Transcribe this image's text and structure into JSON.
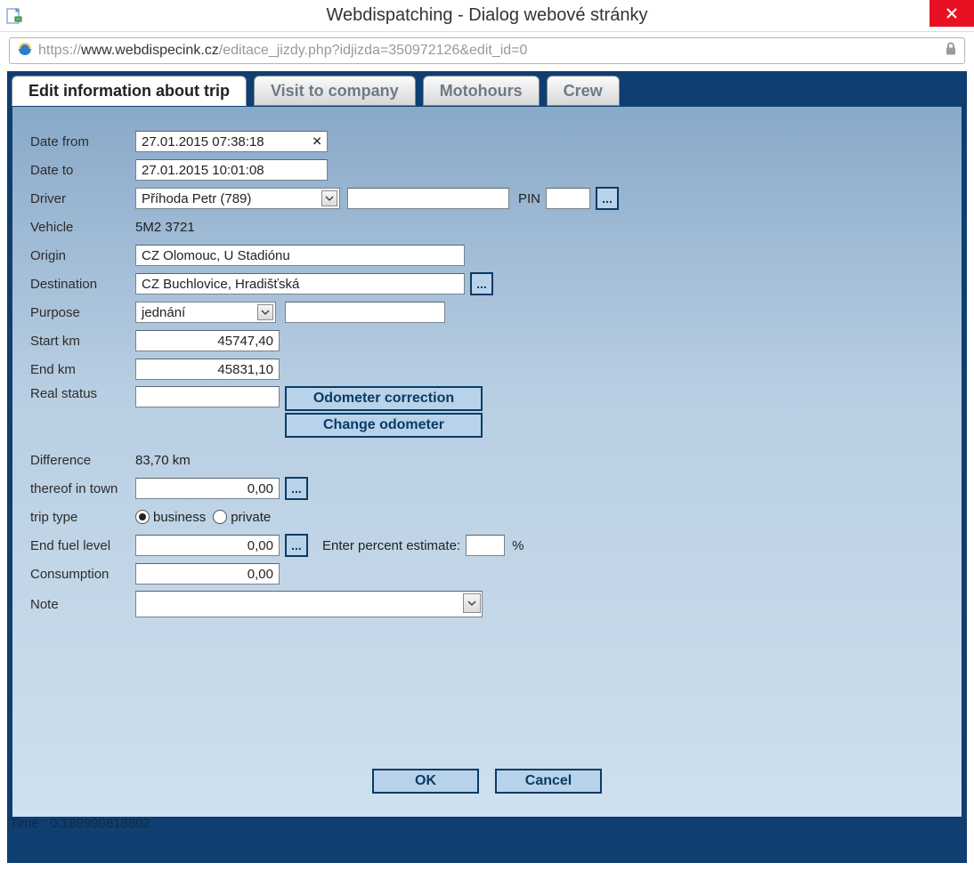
{
  "window": {
    "title": "Webdispatching - Dialog webové stránky",
    "close_label": "✕"
  },
  "url": {
    "proto": "https://",
    "host": "www.webdispecink.cz",
    "path": "/editace_jizdy.php?idjizda=350972126&edit_id=0"
  },
  "tabs": [
    "Edit information about trip",
    "Visit to company",
    "Motohours",
    "Crew"
  ],
  "labels": {
    "date_from": "Date from",
    "date_to": "Date to",
    "driver": "Driver",
    "pin": "PIN",
    "vehicle": "Vehicle",
    "origin": "Origin",
    "destination": "Destination",
    "purpose": "Purpose",
    "start_km": "Start km",
    "end_km": "End km",
    "real_status": "Real status",
    "difference": "Difference",
    "thereof_in_town": "thereof in town",
    "trip_type": "trip type",
    "end_fuel": "End fuel level",
    "enter_percent": "Enter percent estimate:",
    "pct": "%",
    "consumption": "Consumption",
    "note": "Note"
  },
  "values": {
    "date_from": "27.01.2015 07:38:18",
    "date_to": "27.01.2015 10:01:08",
    "driver": "Příhoda Petr (789)",
    "driver_extra": "",
    "pin": "",
    "vehicle": "5M2 3721",
    "origin": "CZ Olomouc, U Stadiónu",
    "destination": "CZ Buchlovice, Hradišťská",
    "purpose": "jednání",
    "purpose_extra": "",
    "start_km": "45747,40",
    "end_km": "45831,10",
    "real_status": "",
    "difference": "83,70 km",
    "in_town": "0,00",
    "trip_type_business": "business",
    "trip_type_private": "private",
    "end_fuel": "0,00",
    "percent_est": "",
    "consumption": "0,00",
    "note": ""
  },
  "buttons": {
    "odometer_correction": "Odometer correction",
    "change_odometer": "Change odometer",
    "ok": "OK",
    "cancel": "Cancel",
    "dots": "..."
  },
  "footer": {
    "time": "Time : 0.189999818802"
  }
}
